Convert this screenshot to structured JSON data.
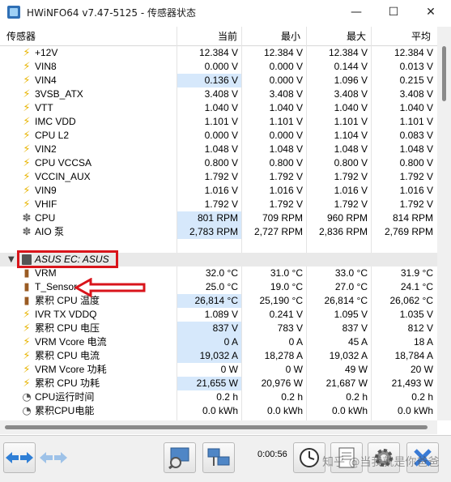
{
  "window": {
    "title": "HWiNFO64 v7.47-5125 - 传感器状态",
    "minimize_icon": "—",
    "maximize_icon": "☐",
    "close_icon": "✕"
  },
  "columns": {
    "sensor": "传感器",
    "current": "当前",
    "min": "最小",
    "max": "最大",
    "avg": "平均"
  },
  "rows_top": [
    {
      "icon": "bolt",
      "name": "+12V",
      "current": "12.384 V",
      "min": "12.384 V",
      "max": "12.384 V",
      "avg": "12.384 V",
      "hl": false
    },
    {
      "icon": "bolt",
      "name": "VIN8",
      "current": "0.000 V",
      "min": "0.000 V",
      "max": "0.144 V",
      "avg": "0.013 V",
      "hl": false
    },
    {
      "icon": "bolt",
      "name": "VIN4",
      "current": "0.136 V",
      "min": "0.000 V",
      "max": "1.096 V",
      "avg": "0.215 V",
      "hl": true
    },
    {
      "icon": "bolt",
      "name": "3VSB_ATX",
      "current": "3.408 V",
      "min": "3.408 V",
      "max": "3.408 V",
      "avg": "3.408 V",
      "hl": false
    },
    {
      "icon": "bolt",
      "name": "VTT",
      "current": "1.040 V",
      "min": "1.040 V",
      "max": "1.040 V",
      "avg": "1.040 V",
      "hl": false
    },
    {
      "icon": "bolt",
      "name": "IMC VDD",
      "current": "1.101 V",
      "min": "1.101 V",
      "max": "1.101 V",
      "avg": "1.101 V",
      "hl": false
    },
    {
      "icon": "bolt",
      "name": "CPU L2",
      "current": "0.000 V",
      "min": "0.000 V",
      "max": "1.104 V",
      "avg": "0.083 V",
      "hl": false
    },
    {
      "icon": "bolt",
      "name": "VIN2",
      "current": "1.048 V",
      "min": "1.048 V",
      "max": "1.048 V",
      "avg": "1.048 V",
      "hl": false
    },
    {
      "icon": "bolt",
      "name": "CPU VCCSA",
      "current": "0.800 V",
      "min": "0.800 V",
      "max": "0.800 V",
      "avg": "0.800 V",
      "hl": false
    },
    {
      "icon": "bolt",
      "name": "VCCIN_AUX",
      "current": "1.792 V",
      "min": "1.792 V",
      "max": "1.792 V",
      "avg": "1.792 V",
      "hl": false
    },
    {
      "icon": "bolt",
      "name": "VIN9",
      "current": "1.016 V",
      "min": "1.016 V",
      "max": "1.016 V",
      "avg": "1.016 V",
      "hl": false
    },
    {
      "icon": "bolt",
      "name": "VHIF",
      "current": "1.792 V",
      "min": "1.792 V",
      "max": "1.792 V",
      "avg": "1.792 V",
      "hl": false
    },
    {
      "icon": "fan",
      "name": "CPU",
      "current": "801 RPM",
      "min": "709 RPM",
      "max": "960 RPM",
      "avg": "814 RPM",
      "hl": true
    },
    {
      "icon": "fan",
      "name": "AIO 泵",
      "current": "2,783 RPM",
      "min": "2,727 RPM",
      "max": "2,836 RPM",
      "avg": "2,769 RPM",
      "hl": true
    }
  ],
  "group": {
    "name": "ASUS EC: ASUS"
  },
  "rows_bottom": [
    {
      "icon": "therm",
      "name": "VRM",
      "current": "32.0 °C",
      "min": "31.0 °C",
      "max": "33.0 °C",
      "avg": "31.9 °C",
      "hl": false
    },
    {
      "icon": "therm",
      "name": "T_Sensor",
      "current": "25.0 °C",
      "min": "19.0 °C",
      "max": "27.0 °C",
      "avg": "24.1 °C",
      "hl": false
    },
    {
      "icon": "therm",
      "name": "累积 CPU 温度",
      "current": "26,814 °C",
      "min": "25,190 °C",
      "max": "26,814 °C",
      "avg": "26,062 °C",
      "hl": true
    },
    {
      "icon": "bolt",
      "name": "IVR TX VDDQ",
      "current": "1.089 V",
      "min": "0.241 V",
      "max": "1.095 V",
      "avg": "1.035 V",
      "hl": false
    },
    {
      "icon": "bolt",
      "name": "累积 CPU 电压",
      "current": "837 V",
      "min": "783 V",
      "max": "837 V",
      "avg": "812 V",
      "hl": true
    },
    {
      "icon": "bolt",
      "name": "VRM Vcore 电流",
      "current": "0 A",
      "min": "0 A",
      "max": "45 A",
      "avg": "18 A",
      "hl": true
    },
    {
      "icon": "bolt",
      "name": "累积 CPU 电流",
      "current": "19,032 A",
      "min": "18,278 A",
      "max": "19,032 A",
      "avg": "18,784 A",
      "hl": true
    },
    {
      "icon": "bolt",
      "name": "VRM Vcore 功耗",
      "current": "0 W",
      "min": "0 W",
      "max": "49 W",
      "avg": "20 W",
      "hl": false
    },
    {
      "icon": "bolt",
      "name": "累积 CPU 功耗",
      "current": "21,655 W",
      "min": "20,976 W",
      "max": "21,687 W",
      "avg": "21,493 W",
      "hl": true
    },
    {
      "icon": "clock",
      "name": "CPU运行时间",
      "current": "0.2 h",
      "min": "0.2 h",
      "max": "0.2 h",
      "avg": "0.2 h",
      "hl": false
    },
    {
      "icon": "clock",
      "name": "累积CPU电能",
      "current": "0.0 kWh",
      "min": "0.0 kWh",
      "max": "0.0 kWh",
      "avg": "0.0 kWh",
      "hl": false
    }
  ],
  "toolbar": {
    "timer": "0:00:56",
    "watermark": "知乎 @当我就是你爸爸"
  }
}
